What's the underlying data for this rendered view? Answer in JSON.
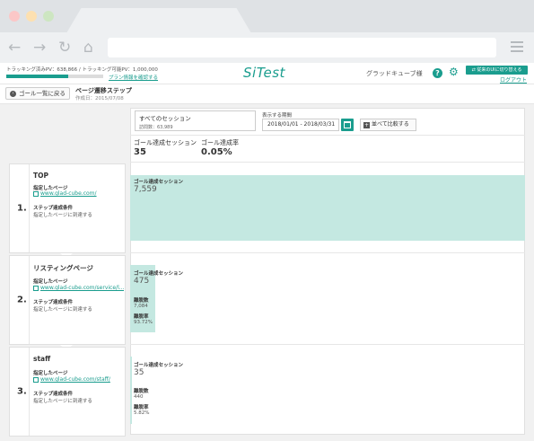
{
  "header": {
    "tracking_text": "トラッキング済みPV：638,866 / トラッキング可能PV：1,000,000",
    "tracking_progress": 0.639,
    "plan_link": "プラン情報を確認する",
    "logo": "SiTest",
    "user_name": "グラッドキューブ様",
    "switch_button": "⇄ 従来のUIに切り替える",
    "logout": "ログアウト"
  },
  "subheader": {
    "back_button": "ゴール一覧に戻る",
    "page_title": "ページ遷移ステップ",
    "created": "作成日：2015/07/08"
  },
  "controls": {
    "segment_title": "すべてのセッション",
    "segment_visits": "訪問数：63,989",
    "period_label": "表示する期間",
    "period_value": "2018/01/01 - 2018/03/31",
    "compare_button": "並べて比較する"
  },
  "metrics": {
    "goal_sessions_label": "ゴール達成セッション",
    "goal_sessions_value": "35",
    "goal_rate_label": "ゴール達成率",
    "goal_rate_value": "0.05%"
  },
  "steps": [
    {
      "num": "1.",
      "name": "TOP",
      "page_label": "指定したページ",
      "url": "www.glad-cube.com/",
      "cond_label": "ステップ達成条件",
      "cond_text": "指定したページに到達する",
      "bar_label": "ゴール達成セッション",
      "bar_value": "7,559",
      "bar_fraction": 1.0
    },
    {
      "num": "2.",
      "name": "リスティングページ",
      "page_label": "指定したページ",
      "url": "www.glad-cube.com/service/l...",
      "cond_label": "ステップ達成条件",
      "cond_text": "指定したページに到達する",
      "bar_label": "ゴール達成セッション",
      "bar_value": "475",
      "bar_fraction": 0.063,
      "drop_label": "離脱数",
      "drop_value": "7,084",
      "drop_rate_label": "離脱率",
      "drop_rate_value": "93.72%"
    },
    {
      "num": "3.",
      "name": "staff",
      "page_label": "指定したページ",
      "url": "www.glad-cube.com/staff/",
      "cond_label": "ステップ達成条件",
      "cond_text": "指定したページに到達する",
      "bar_label": "ゴール達成セッション",
      "bar_value": "35",
      "bar_fraction": 0.005,
      "drop_label": "離脱数",
      "drop_value": "440",
      "drop_rate_label": "離脱率",
      "drop_rate_value": "5.82%"
    }
  ]
}
